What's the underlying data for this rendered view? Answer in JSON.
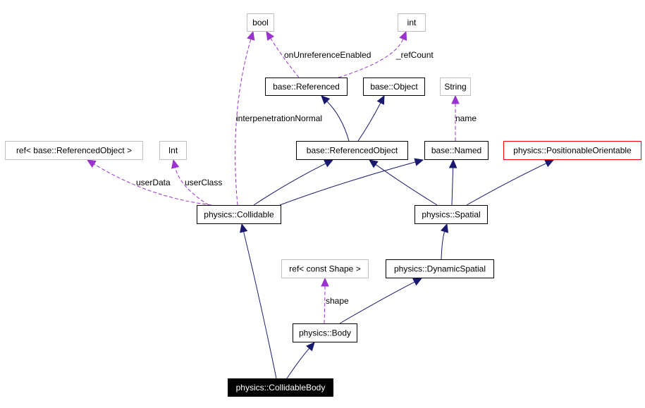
{
  "colors": {
    "inheritance_edge": "#191970",
    "member_edge": "#9a32cd",
    "class_border": "#000000",
    "external_type_border": "#bfbfbf",
    "undocumented_border": "#ff0000",
    "focus_fill": "#000000",
    "focus_text": "#ffffff"
  },
  "nodes": {
    "bool": {
      "label": "bool",
      "kind": "external"
    },
    "int": {
      "label": "int",
      "kind": "external"
    },
    "referenced": {
      "label": "base::Referenced",
      "kind": "class"
    },
    "object": {
      "label": "base::Object",
      "kind": "class"
    },
    "string": {
      "label": "String",
      "kind": "external"
    },
    "ref_ro": {
      "label": "ref< base::ReferencedObject >",
      "kind": "external"
    },
    "Int": {
      "label": "Int",
      "kind": "external"
    },
    "refobj": {
      "label": "base::ReferencedObject",
      "kind": "class"
    },
    "named": {
      "label": "base::Named",
      "kind": "class"
    },
    "posor": {
      "label": "physics::PositionableOrientable",
      "kind": "undocumented"
    },
    "collidable": {
      "label": "physics::Collidable",
      "kind": "class"
    },
    "spatial": {
      "label": "physics::Spatial",
      "kind": "class"
    },
    "ref_shape": {
      "label": "ref< const Shape >",
      "kind": "external"
    },
    "dynspatial": {
      "label": "physics::DynamicSpatial",
      "kind": "class"
    },
    "body": {
      "label": "physics::Body",
      "kind": "class"
    },
    "collbody": {
      "label": "physics::CollidableBody",
      "kind": "focus"
    }
  },
  "edges": [
    {
      "from": "refobj",
      "to": "referenced",
      "type": "inheritance"
    },
    {
      "from": "refobj",
      "to": "object",
      "type": "inheritance"
    },
    {
      "from": "collidable",
      "to": "refobj",
      "type": "inheritance"
    },
    {
      "from": "collidable",
      "to": "named",
      "type": "inheritance"
    },
    {
      "from": "spatial",
      "to": "refobj",
      "type": "inheritance"
    },
    {
      "from": "spatial",
      "to": "named",
      "type": "inheritance"
    },
    {
      "from": "spatial",
      "to": "posor",
      "type": "inheritance"
    },
    {
      "from": "dynspatial",
      "to": "spatial",
      "type": "inheritance"
    },
    {
      "from": "body",
      "to": "dynspatial",
      "type": "inheritance"
    },
    {
      "from": "collbody",
      "to": "collidable",
      "type": "inheritance"
    },
    {
      "from": "collbody",
      "to": "body",
      "type": "inheritance"
    },
    {
      "from": "collidable",
      "to": "bool",
      "type": "member",
      "label": "interpenetrationNormal"
    },
    {
      "from": "referenced",
      "to": "bool",
      "type": "member",
      "label": "onUnreferenceEnabled"
    },
    {
      "from": "referenced",
      "to": "int",
      "type": "member",
      "label": "_refCount"
    },
    {
      "from": "collidable",
      "to": "ref_ro",
      "type": "member",
      "label": "userData"
    },
    {
      "from": "collidable",
      "to": "Int",
      "type": "member",
      "label": "userClass"
    },
    {
      "from": "named",
      "to": "string",
      "type": "member",
      "label": "name"
    },
    {
      "from": "body",
      "to": "ref_shape",
      "type": "member",
      "label": "shape"
    }
  ]
}
